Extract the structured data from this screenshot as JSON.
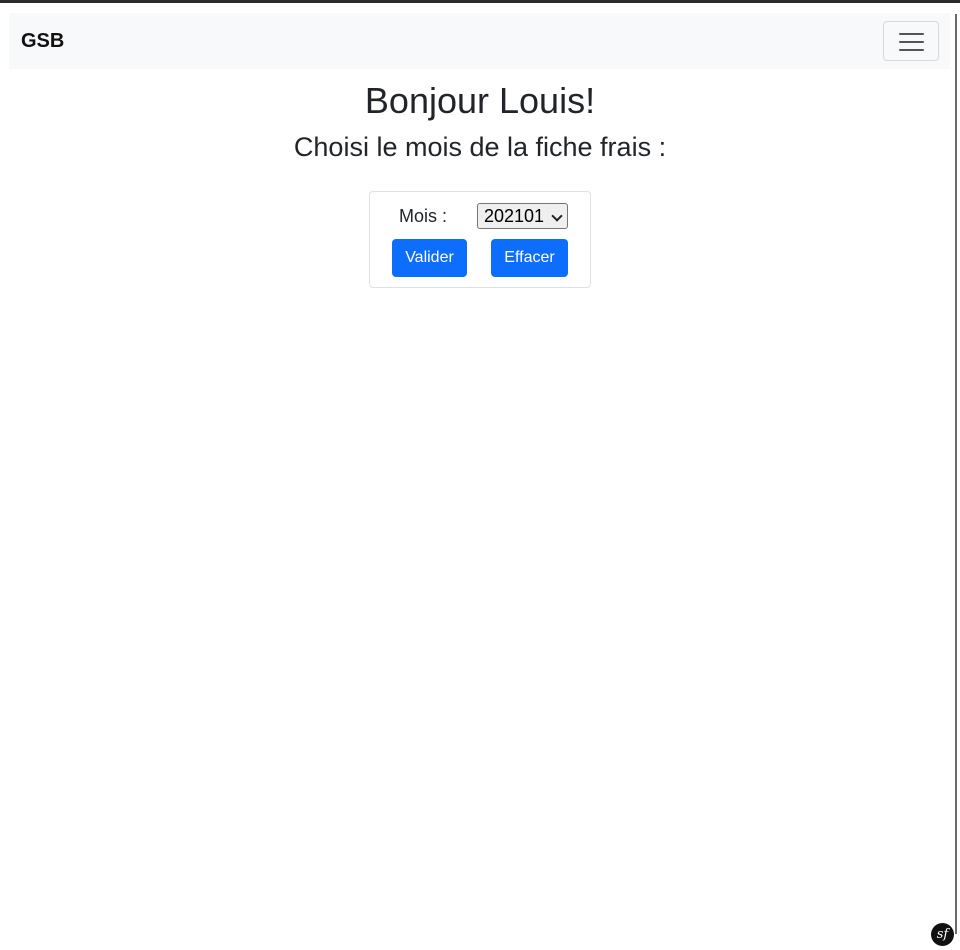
{
  "navbar": {
    "brand": "GSB",
    "menu_icon": "hamburger-menu-icon"
  },
  "main": {
    "greeting": "Bonjour Louis!",
    "prompt": "Choisi le mois de la fiche frais :"
  },
  "form": {
    "mois_label": "Mois :",
    "mois_selected": "202101",
    "valider_label": "Valider",
    "effacer_label": "Effacer"
  },
  "debug_toolbar": {
    "badge_text": "sf",
    "icon": "symfony-logo-icon"
  },
  "colors": {
    "primary_button": "#0d6efd",
    "navbar_bg": "#f8f9fa",
    "text": "#212529"
  }
}
